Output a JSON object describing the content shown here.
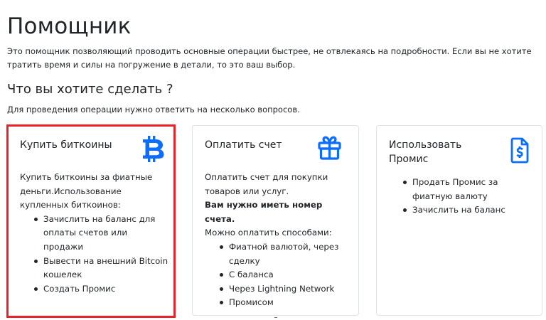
{
  "page": {
    "title": "Помощник",
    "intro": "Это помощник позволяющий проводить основные операции быстрее, не отвлекаясь на подробности. Если вы не хотите тратить время и силы на погружение в детали, то это ваш выбор.",
    "section_title": "Что вы хотите сделать ?",
    "section_sub": "Для проведения операции нужно ответить на несколько вопросов."
  },
  "colors": {
    "accent": "#0d6efd",
    "selected_border": "#e8232a",
    "text": "#212529"
  },
  "cards": [
    {
      "title": "Купить биткоины",
      "icon": "bitcoin-icon",
      "selected": true,
      "description": "Купить биткоины за фиатные деньги.Использование купленных биткоинов:",
      "items": [
        "Зачислить на баланс для оплаты счетов или продажи",
        "Вывести на внешний Bitcoin кошелек",
        "Создать Промис"
      ]
    },
    {
      "title": "Оплатить счет",
      "icon": "gift-icon",
      "selected": false,
      "description": "Оплатить счет для покупки товаров или услуг.",
      "note": "Вам нужно иметь номер счета.",
      "methods_label": "Можно оплатить способами:",
      "items": [
        "Фиатной валютой, через сделку",
        "С баланса",
        "Через Lightning Network",
        "Промисом"
      ]
    },
    {
      "title": "Использовать Промис",
      "icon": "receipt-icon",
      "selected": false,
      "items": [
        "Продать Промис за фиатную валюту",
        "Зачислить на баланс"
      ]
    }
  ]
}
